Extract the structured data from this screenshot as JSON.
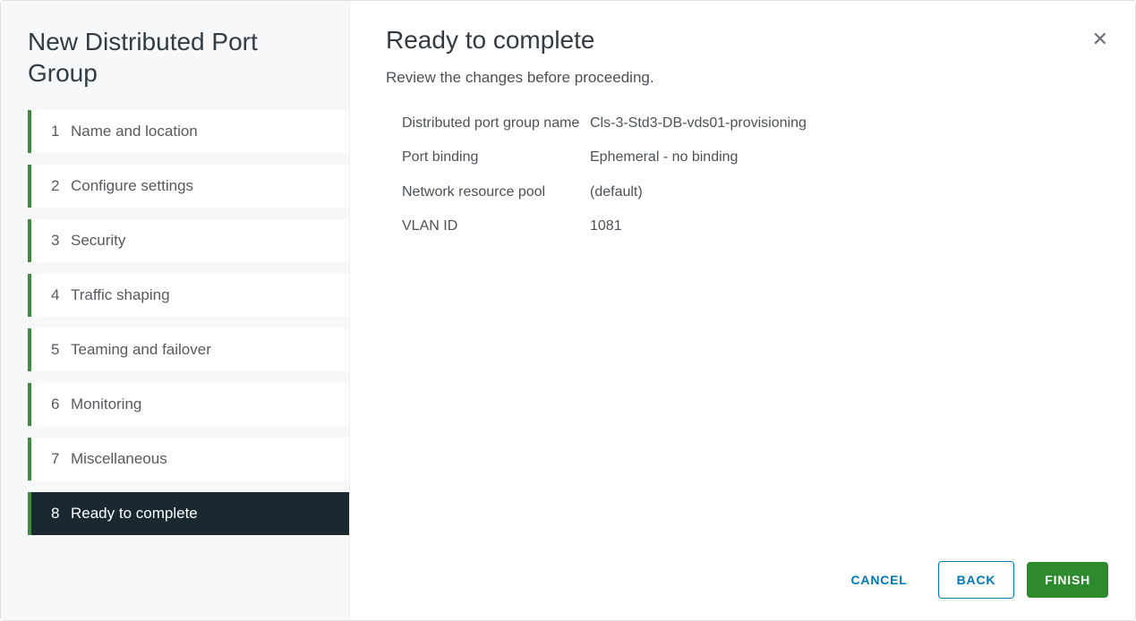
{
  "sidebar": {
    "title": "New Distributed Port Group",
    "steps": [
      {
        "num": "1",
        "label": "Name and location",
        "active": false
      },
      {
        "num": "2",
        "label": "Configure settings",
        "active": false
      },
      {
        "num": "3",
        "label": "Security",
        "active": false
      },
      {
        "num": "4",
        "label": "Traffic shaping",
        "active": false
      },
      {
        "num": "5",
        "label": "Teaming and failover",
        "active": false
      },
      {
        "num": "6",
        "label": "Monitoring",
        "active": false
      },
      {
        "num": "7",
        "label": "Miscellaneous",
        "active": false
      },
      {
        "num": "8",
        "label": "Ready to complete",
        "active": true
      }
    ]
  },
  "main": {
    "title": "Ready to complete",
    "subtitle": "Review the changes before proceeding.",
    "rows": [
      {
        "label": "Distributed port group name",
        "value": "Cls-3-Std3-DB-vds01-provisioning"
      },
      {
        "label": "Port binding",
        "value": "Ephemeral - no binding"
      },
      {
        "label": "Network resource pool",
        "value": "(default)"
      },
      {
        "label": "VLAN ID",
        "value": "1081"
      }
    ]
  },
  "footer": {
    "cancel": "CANCEL",
    "back": "BACK",
    "finish": "FINISH"
  },
  "close_icon": "✕"
}
